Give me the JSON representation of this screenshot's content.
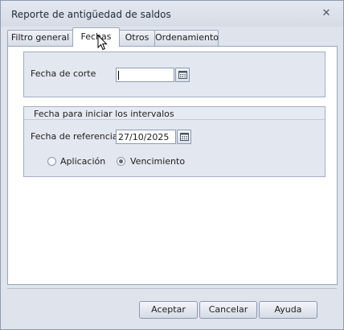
{
  "window": {
    "title": "Reporte de antigüedad de saldos",
    "close_glyph": "✕"
  },
  "tabs": [
    {
      "label": "Filtro general",
      "active": false
    },
    {
      "label": "Fechas",
      "active": true
    },
    {
      "label": "Otros",
      "active": false
    },
    {
      "label": "Ordenamiento",
      "active": false
    }
  ],
  "fecha_corte": {
    "label": "Fecha de corte",
    "value": "",
    "icon": "calendar-icon"
  },
  "intervalos": {
    "group_title": "Fecha para iniciar los intervalos",
    "fecha_referencia_label": "Fecha de referencia",
    "fecha_referencia_value": "27/10/2025",
    "icon": "calendar-icon",
    "options": [
      {
        "label": "Aplicación",
        "selected": false
      },
      {
        "label": "Vencimiento",
        "selected": true
      }
    ]
  },
  "buttons": {
    "aceptar": "Aceptar",
    "cancelar": "Cancelar",
    "ayuda": "Ayuda"
  },
  "colors": {
    "window_bg": "#dfe3ec",
    "group_bg": "#e3e7f0",
    "border": "#99a6bb"
  }
}
